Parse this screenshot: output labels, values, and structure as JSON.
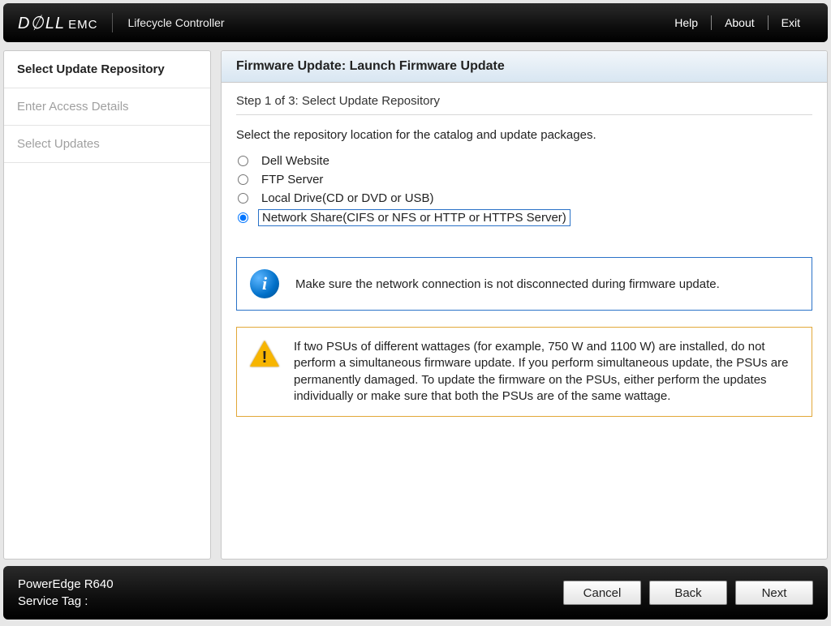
{
  "header": {
    "brand_dell": "D&#9696;LL",
    "brand_emc": "EMC",
    "app_title": "Lifecycle Controller",
    "links": {
      "help": "Help",
      "about": "About",
      "exit": "Exit"
    }
  },
  "sidebar": {
    "items": [
      {
        "label": "Select Update Repository",
        "active": true
      },
      {
        "label": "Enter Access Details",
        "active": false
      },
      {
        "label": "Select Updates",
        "active": false
      }
    ]
  },
  "main": {
    "title": "Firmware Update: Launch Firmware Update",
    "step": "Step 1 of 3: Select Update Repository",
    "instruction": "Select the repository location for the catalog and update packages.",
    "options": [
      {
        "label": "Dell Website",
        "selected": false
      },
      {
        "label": "FTP Server",
        "selected": false
      },
      {
        "label": "Local Drive(CD or DVD or USB)",
        "selected": false
      },
      {
        "label": "Network Share(CIFS or NFS or HTTP or HTTPS Server)",
        "selected": true,
        "focused": true
      }
    ],
    "info_note": "Make sure the network connection is not disconnected during firmware update.",
    "warning": "If two PSUs of different wattages (for example, 750 W and 1100 W) are installed, do not perform a simultaneous firmware update. If you perform simultaneous update, the PSUs are permanently damaged. To update the firmware on the PSUs, either perform the updates individually or make sure that both the PSUs are of the same wattage."
  },
  "footer": {
    "model": "PowerEdge R640",
    "service_tag_label": "Service Tag :",
    "buttons": {
      "cancel": "Cancel",
      "back": "Back",
      "next": "Next"
    }
  }
}
